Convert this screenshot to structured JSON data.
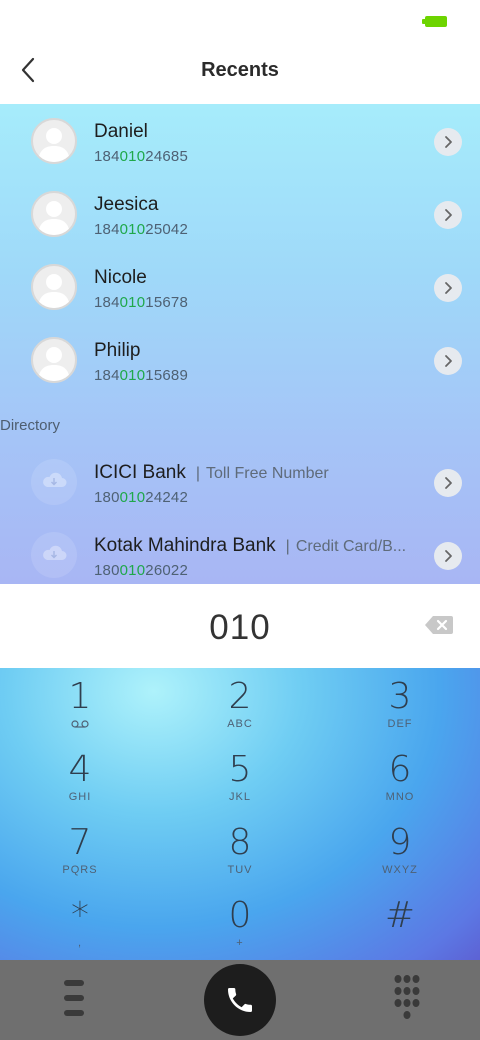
{
  "header": {
    "title": "Recents",
    "back_icon": "chevron-left-icon"
  },
  "status_bar": {
    "battery_color": "#6dd400"
  },
  "contacts": [
    {
      "name": "Daniel",
      "number_prefix": "184",
      "number_match": "010",
      "number_suffix": "24685"
    },
    {
      "name": "Jeesica",
      "number_prefix": "184",
      "number_match": "010",
      "number_suffix": "25042"
    },
    {
      "name": "Nicole",
      "number_prefix": "184",
      "number_match": "010",
      "number_suffix": "15678"
    },
    {
      "name": "Philip",
      "number_prefix": "184",
      "number_match": "010",
      "number_suffix": "15689"
    }
  ],
  "directory": {
    "label": "Directory",
    "entries": [
      {
        "name": "ICICI Bank",
        "separator": "|",
        "category": "Toll Free Number",
        "number_prefix": "180",
        "number_match": "010",
        "number_suffix": "24242"
      },
      {
        "name": "Kotak Mahindra Bank",
        "separator": "|",
        "category": "Credit Card/B...",
        "number_prefix": "180",
        "number_match": "010",
        "number_suffix": "26022"
      }
    ]
  },
  "dialer": {
    "dialed_number": "010",
    "keys": [
      {
        "digit": "1",
        "letters": ""
      },
      {
        "digit": "2",
        "letters": "ABC"
      },
      {
        "digit": "3",
        "letters": "DEF"
      },
      {
        "digit": "4",
        "letters": "GHI"
      },
      {
        "digit": "5",
        "letters": "JKL"
      },
      {
        "digit": "6",
        "letters": "MNO"
      },
      {
        "digit": "7",
        "letters": "PQRS"
      },
      {
        "digit": "8",
        "letters": "TUV"
      },
      {
        "digit": "9",
        "letters": "WXYZ"
      },
      {
        "digit": "*",
        "letters": ","
      },
      {
        "digit": "0",
        "letters": "+"
      },
      {
        "digit": "#",
        "letters": ""
      }
    ]
  },
  "colors": {
    "match_highlight": "#1fa84a",
    "call_button": "#1d1d1d",
    "bottom_bar": "#6f6f6f"
  }
}
